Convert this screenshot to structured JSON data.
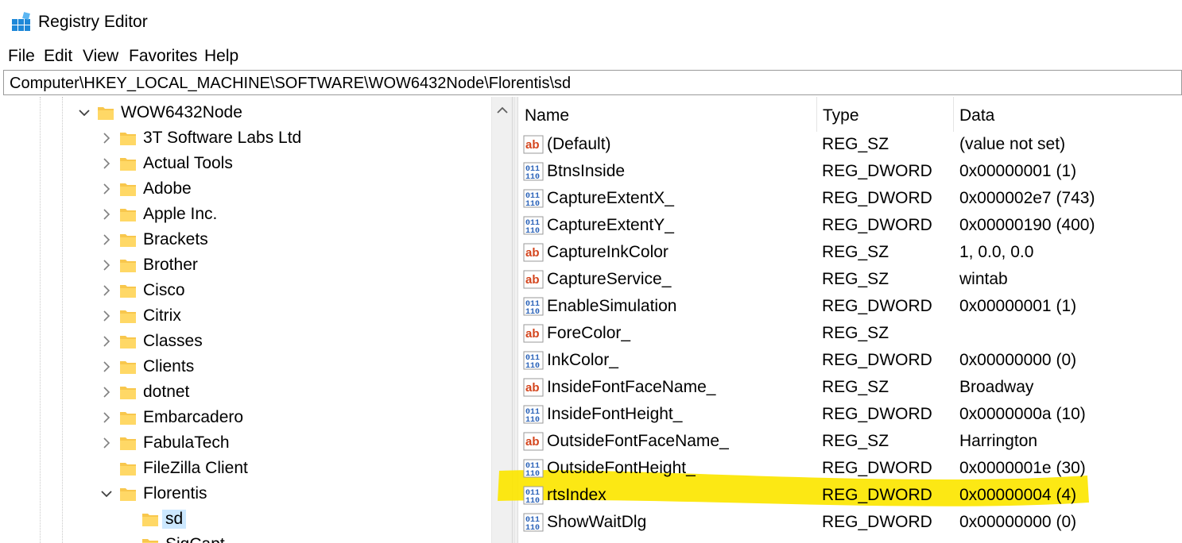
{
  "window": {
    "title": "Registry Editor",
    "app_icon": "registry-editor-icon"
  },
  "menu": [
    "File",
    "Edit",
    "View",
    "Favorites",
    "Help"
  ],
  "address": "Computer\\HKEY_LOCAL_MACHINE\\SOFTWARE\\WOW6432Node\\Florentis\\sd",
  "tree": [
    {
      "label": "WOW6432Node",
      "state": "expanded"
    },
    {
      "label": "3T Software Labs Ltd",
      "state": "collapsed"
    },
    {
      "label": "Actual Tools",
      "state": "collapsed"
    },
    {
      "label": "Adobe",
      "state": "collapsed"
    },
    {
      "label": "Apple Inc.",
      "state": "collapsed"
    },
    {
      "label": "Brackets",
      "state": "collapsed"
    },
    {
      "label": "Brother",
      "state": "collapsed"
    },
    {
      "label": "Cisco",
      "state": "collapsed"
    },
    {
      "label": "Citrix",
      "state": "collapsed"
    },
    {
      "label": "Classes",
      "state": "collapsed"
    },
    {
      "label": "Clients",
      "state": "collapsed"
    },
    {
      "label": "dotnet",
      "state": "collapsed"
    },
    {
      "label": "Embarcadero",
      "state": "collapsed"
    },
    {
      "label": "FabulaTech",
      "state": "collapsed"
    },
    {
      "label": "FileZilla Client",
      "state": "leaf"
    },
    {
      "label": "Florentis",
      "state": "expanded"
    },
    {
      "label": "sd",
      "state": "selected"
    },
    {
      "label": "SigCapt",
      "state": "leaf"
    }
  ],
  "columns": {
    "name": "Name",
    "type": "Type",
    "data": "Data"
  },
  "values": [
    {
      "name": "(Default)",
      "type": "REG_SZ",
      "data": "(value not set)",
      "icon": "string-value-icon"
    },
    {
      "name": "BtnsInside",
      "type": "REG_DWORD",
      "data": "0x00000001 (1)",
      "icon": "binary-value-icon"
    },
    {
      "name": "CaptureExtentX_",
      "type": "REG_DWORD",
      "data": "0x000002e7 (743)",
      "icon": "binary-value-icon"
    },
    {
      "name": "CaptureExtentY_",
      "type": "REG_DWORD",
      "data": "0x00000190 (400)",
      "icon": "binary-value-icon"
    },
    {
      "name": "CaptureInkColor",
      "type": "REG_SZ",
      "data": "1, 0.0, 0.0",
      "icon": "string-value-icon"
    },
    {
      "name": "CaptureService_",
      "type": "REG_SZ",
      "data": "wintab",
      "icon": "string-value-icon"
    },
    {
      "name": "EnableSimulation",
      "type": "REG_DWORD",
      "data": "0x00000001 (1)",
      "icon": "binary-value-icon"
    },
    {
      "name": "ForeColor_",
      "type": "REG_SZ",
      "data": "",
      "icon": "string-value-icon"
    },
    {
      "name": "InkColor_",
      "type": "REG_DWORD",
      "data": "0x00000000 (0)",
      "icon": "binary-value-icon"
    },
    {
      "name": "InsideFontFaceName_",
      "type": "REG_SZ",
      "data": "Broadway",
      "icon": "string-value-icon"
    },
    {
      "name": "InsideFontHeight_",
      "type": "REG_DWORD",
      "data": "0x0000000a (10)",
      "icon": "binary-value-icon"
    },
    {
      "name": "OutsideFontFaceName_",
      "type": "REG_SZ",
      "data": "Harrington",
      "icon": "string-value-icon"
    },
    {
      "name": "OutsideFontHeight_",
      "type": "REG_DWORD",
      "data": "0x0000001e (30)",
      "icon": "binary-value-icon"
    },
    {
      "name": "rtsIndex",
      "type": "REG_DWORD",
      "data": "0x00000004 (4)",
      "icon": "binary-value-icon",
      "highlighted": true
    },
    {
      "name": "ShowWaitDlg",
      "type": "REG_DWORD",
      "data": "0x00000000 (0)",
      "icon": "binary-value-icon"
    }
  ],
  "colors": {
    "highlight": "#fce600",
    "selection": "#cce8ff",
    "folder": "#f8c74d",
    "string_icon": "#d4451d",
    "binary_icon": "#2a62b8"
  }
}
